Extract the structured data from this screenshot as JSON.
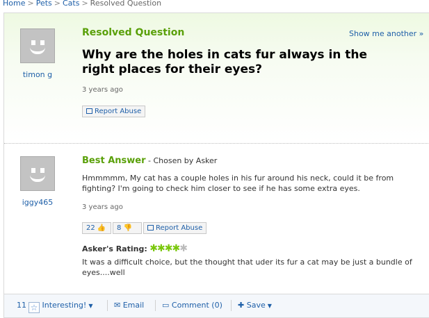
{
  "breadcrumb": {
    "home": "Home",
    "pets": "Pets",
    "cats": "Cats",
    "current": "Resolved Question",
    "sep": ">"
  },
  "question": {
    "asker": "timon g",
    "status": "Resolved Question",
    "show_another": "Show me another »",
    "title": "Why are the holes in cats fur always in the right places for their eyes?",
    "time": "3 years ago",
    "report": "Report Abuse"
  },
  "answer": {
    "user": "iggy465",
    "label": "Best Answer",
    "chosen": " - Chosen by Asker",
    "text": "Hmmmmm, My cat has a couple holes in his fur around his neck, could it be from fighting? I'm going to check him closer to see if he has some extra eyes.",
    "time": "3 years ago",
    "thumbs_up": "22",
    "thumbs_down": "8",
    "report": "Report Abuse",
    "rating_label": "Asker's Rating:",
    "rating_stars": 4,
    "rating_max": 5,
    "comment": "It was a difficult choice, but the thought that uder its fur a cat may be just a bundle of eyes....well"
  },
  "actions": {
    "interesting_count": "11",
    "interesting": "Interesting!",
    "email": "Email",
    "comment": "Comment (0)",
    "save": "Save"
  },
  "colors": {
    "accent_green": "#5aa00a",
    "link_blue": "#1e5fa8",
    "star_on": "#7ac70c"
  }
}
